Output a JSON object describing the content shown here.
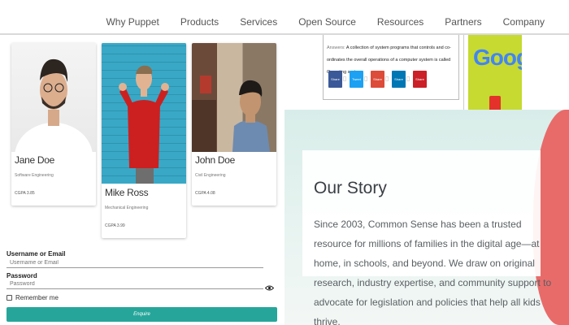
{
  "nav": {
    "items": [
      "Why Puppet",
      "Products",
      "Services",
      "Open Source",
      "Resources",
      "Partners",
      "Company"
    ]
  },
  "cards": [
    {
      "name": "Jane Doe",
      "role": "Software Engineering",
      "gpa": "CGPA 3.85"
    },
    {
      "name": "Mike Ross",
      "role": "Mechanical Engineering",
      "gpa": "CGPA 3.99"
    },
    {
      "name": "John Doe",
      "role": "Civil Engineering",
      "gpa": "CGPA 4.08"
    }
  ],
  "login": {
    "username_label": "Username or Email",
    "username_placeholder": "Username or Email",
    "password_label": "Password",
    "password_placeholder": "Password",
    "remember_label": "Remember me",
    "button_label": "Enquire"
  },
  "answer": {
    "prefix": "Answers:",
    "text": "A collection of system programs that controls and co-ordinates the overall operations of a computer system is called Operating system."
  },
  "share": [
    {
      "label": "Share",
      "color": "#3b5998"
    },
    {
      "label": "Tweet",
      "color": "#1da1f2"
    },
    {
      "label": "Share",
      "color": "#dd4b39"
    },
    {
      "label": "Share",
      "color": "#0077b5"
    },
    {
      "label": "Share",
      "color": "#cb2027"
    }
  ],
  "google_text": "Google",
  "story": {
    "title": "Our Story",
    "body": "Since 2003, Common Sense has been a trusted resource for millions of families in the digital age—at home, in schools, and beyond. We draw on original research, industry expertise, and community support to advocate for legislation and policies that help all kids thrive."
  },
  "colors": {
    "accent": "#26a69a",
    "google_bg": "#c6da31",
    "story_bg": "#d8ede9"
  }
}
